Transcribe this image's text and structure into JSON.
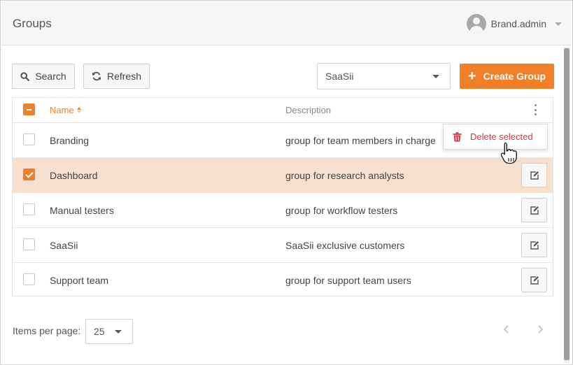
{
  "header": {
    "title": "Groups",
    "user_name": "Brand.admin"
  },
  "toolbar": {
    "search_label": "Search",
    "refresh_label": "Refresh",
    "group_filter_value": "SaaSii",
    "create_label": "Create Group"
  },
  "table": {
    "columns": {
      "name": "Name",
      "description": "Description"
    },
    "rows": [
      {
        "name": "Branding",
        "description": "group for team members in charge",
        "selected": false
      },
      {
        "name": "Dashboard",
        "description": "group for research analysts",
        "selected": true
      },
      {
        "name": "Manual testers",
        "description": "group for workflow testers",
        "selected": false
      },
      {
        "name": "SaaSii",
        "description": "SaaSii exclusive customers",
        "selected": false
      },
      {
        "name": "Support team",
        "description": "group for support team users",
        "selected": false
      }
    ]
  },
  "context_menu": {
    "delete_label": "Delete selected"
  },
  "footer": {
    "items_per_page_label": "Items per page:",
    "items_per_page_value": "25"
  },
  "colors": {
    "accent": "#f07f27",
    "selected_row": "#f6dfcc",
    "danger": "#d9343f"
  }
}
